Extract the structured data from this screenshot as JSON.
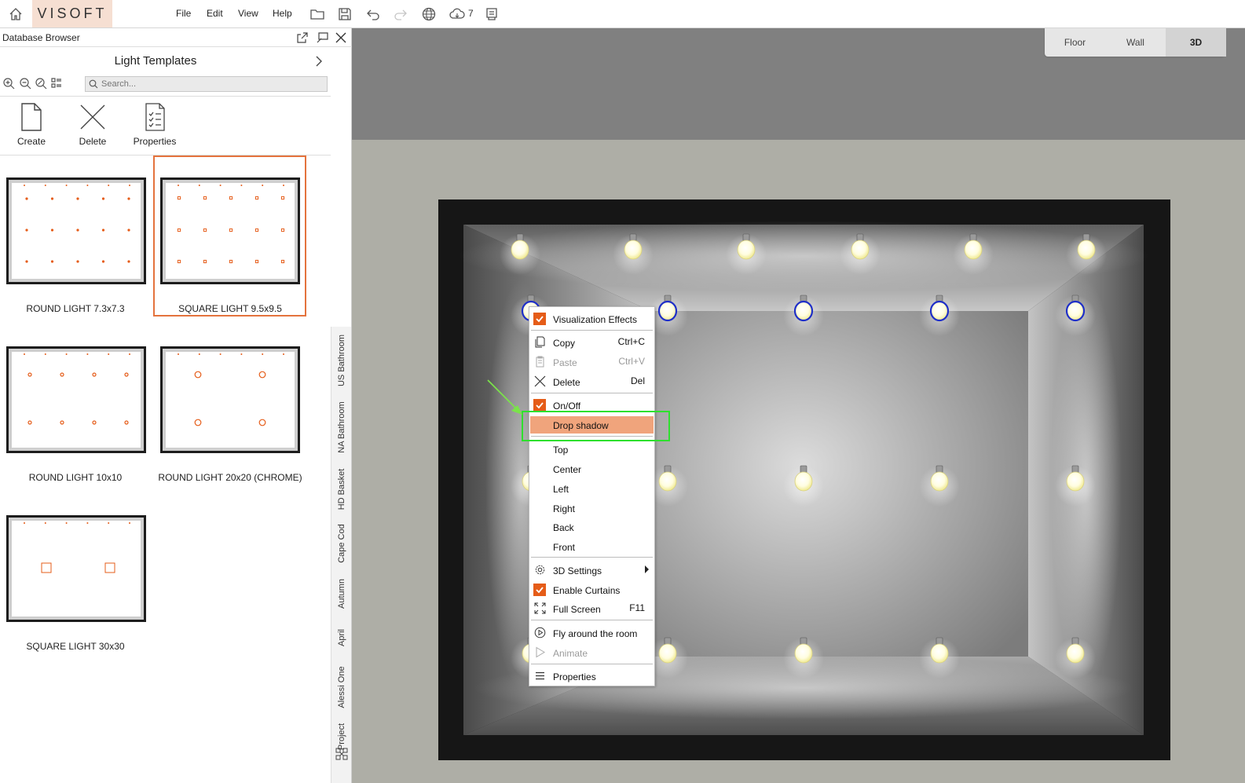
{
  "app": {
    "logo": "VISOFT",
    "menu": [
      "File",
      "Edit",
      "View",
      "Help"
    ],
    "cloud_count": "7"
  },
  "left_panel": {
    "title": "Database Browser",
    "section_title": "Light Templates",
    "search_placeholder": "Search...",
    "actions": [
      "Create",
      "Delete",
      "Properties"
    ],
    "templates": [
      {
        "label": "ROUND LIGHT 7.3x7.3",
        "selected": false
      },
      {
        "label": "SQUARE LIGHT 9.5x9.5",
        "selected": true
      },
      {
        "label": "ROUND LIGHT 10x10",
        "selected": false
      },
      {
        "label": "ROUND LIGHT 20x20 (CHROME)",
        "selected": false
      },
      {
        "label": "SQUARE LIGHT 30x30",
        "selected": false
      }
    ],
    "categories": [
      "US Bathroom",
      "NA Bathroom",
      "HD Basket",
      "Cape Cod",
      "Autumn",
      "April",
      "Alessi One",
      "Project"
    ]
  },
  "view_tabs": {
    "items": [
      "Floor",
      "Wall",
      "3D"
    ],
    "active": "3D"
  },
  "context_menu": {
    "items": [
      {
        "label": "Visualization Effects",
        "shortcut": "",
        "checked": true
      },
      {
        "label": "Copy",
        "shortcut": "Ctrl+C",
        "icon": "copy-icon"
      },
      {
        "label": "Paste",
        "shortcut": "Ctrl+V",
        "icon": "paste-icon",
        "disabled": true
      },
      {
        "label": "Delete",
        "shortcut": "Del",
        "icon": "close-icon"
      },
      {
        "label": "On/Off",
        "shortcut": "",
        "checked": true
      },
      {
        "label": "Drop shadow",
        "shortcut": "",
        "highlighted": true
      },
      {
        "label": "Top",
        "shortcut": ""
      },
      {
        "label": "Center",
        "shortcut": ""
      },
      {
        "label": "Left",
        "shortcut": ""
      },
      {
        "label": "Right",
        "shortcut": ""
      },
      {
        "label": "Back",
        "shortcut": ""
      },
      {
        "label": "Front",
        "shortcut": ""
      },
      {
        "label": "3D Settings",
        "shortcut": "",
        "icon": "gear-icon",
        "submenu": true
      },
      {
        "label": "Enable Curtains",
        "shortcut": "",
        "checked": true
      },
      {
        "label": "Full Screen",
        "shortcut": "F11",
        "icon": "fullscreen-icon"
      },
      {
        "label": "Fly around the room",
        "shortcut": "",
        "icon": "play-circle-icon"
      },
      {
        "label": "Animate",
        "shortcut": "",
        "icon": "play-icon",
        "disabled": true
      },
      {
        "label": "Properties",
        "shortcut": "",
        "icon": "list-icon"
      }
    ]
  },
  "colors": {
    "accent": "#e55c18",
    "highlight": "#f0a47c",
    "annotation": "#2ee02e"
  }
}
